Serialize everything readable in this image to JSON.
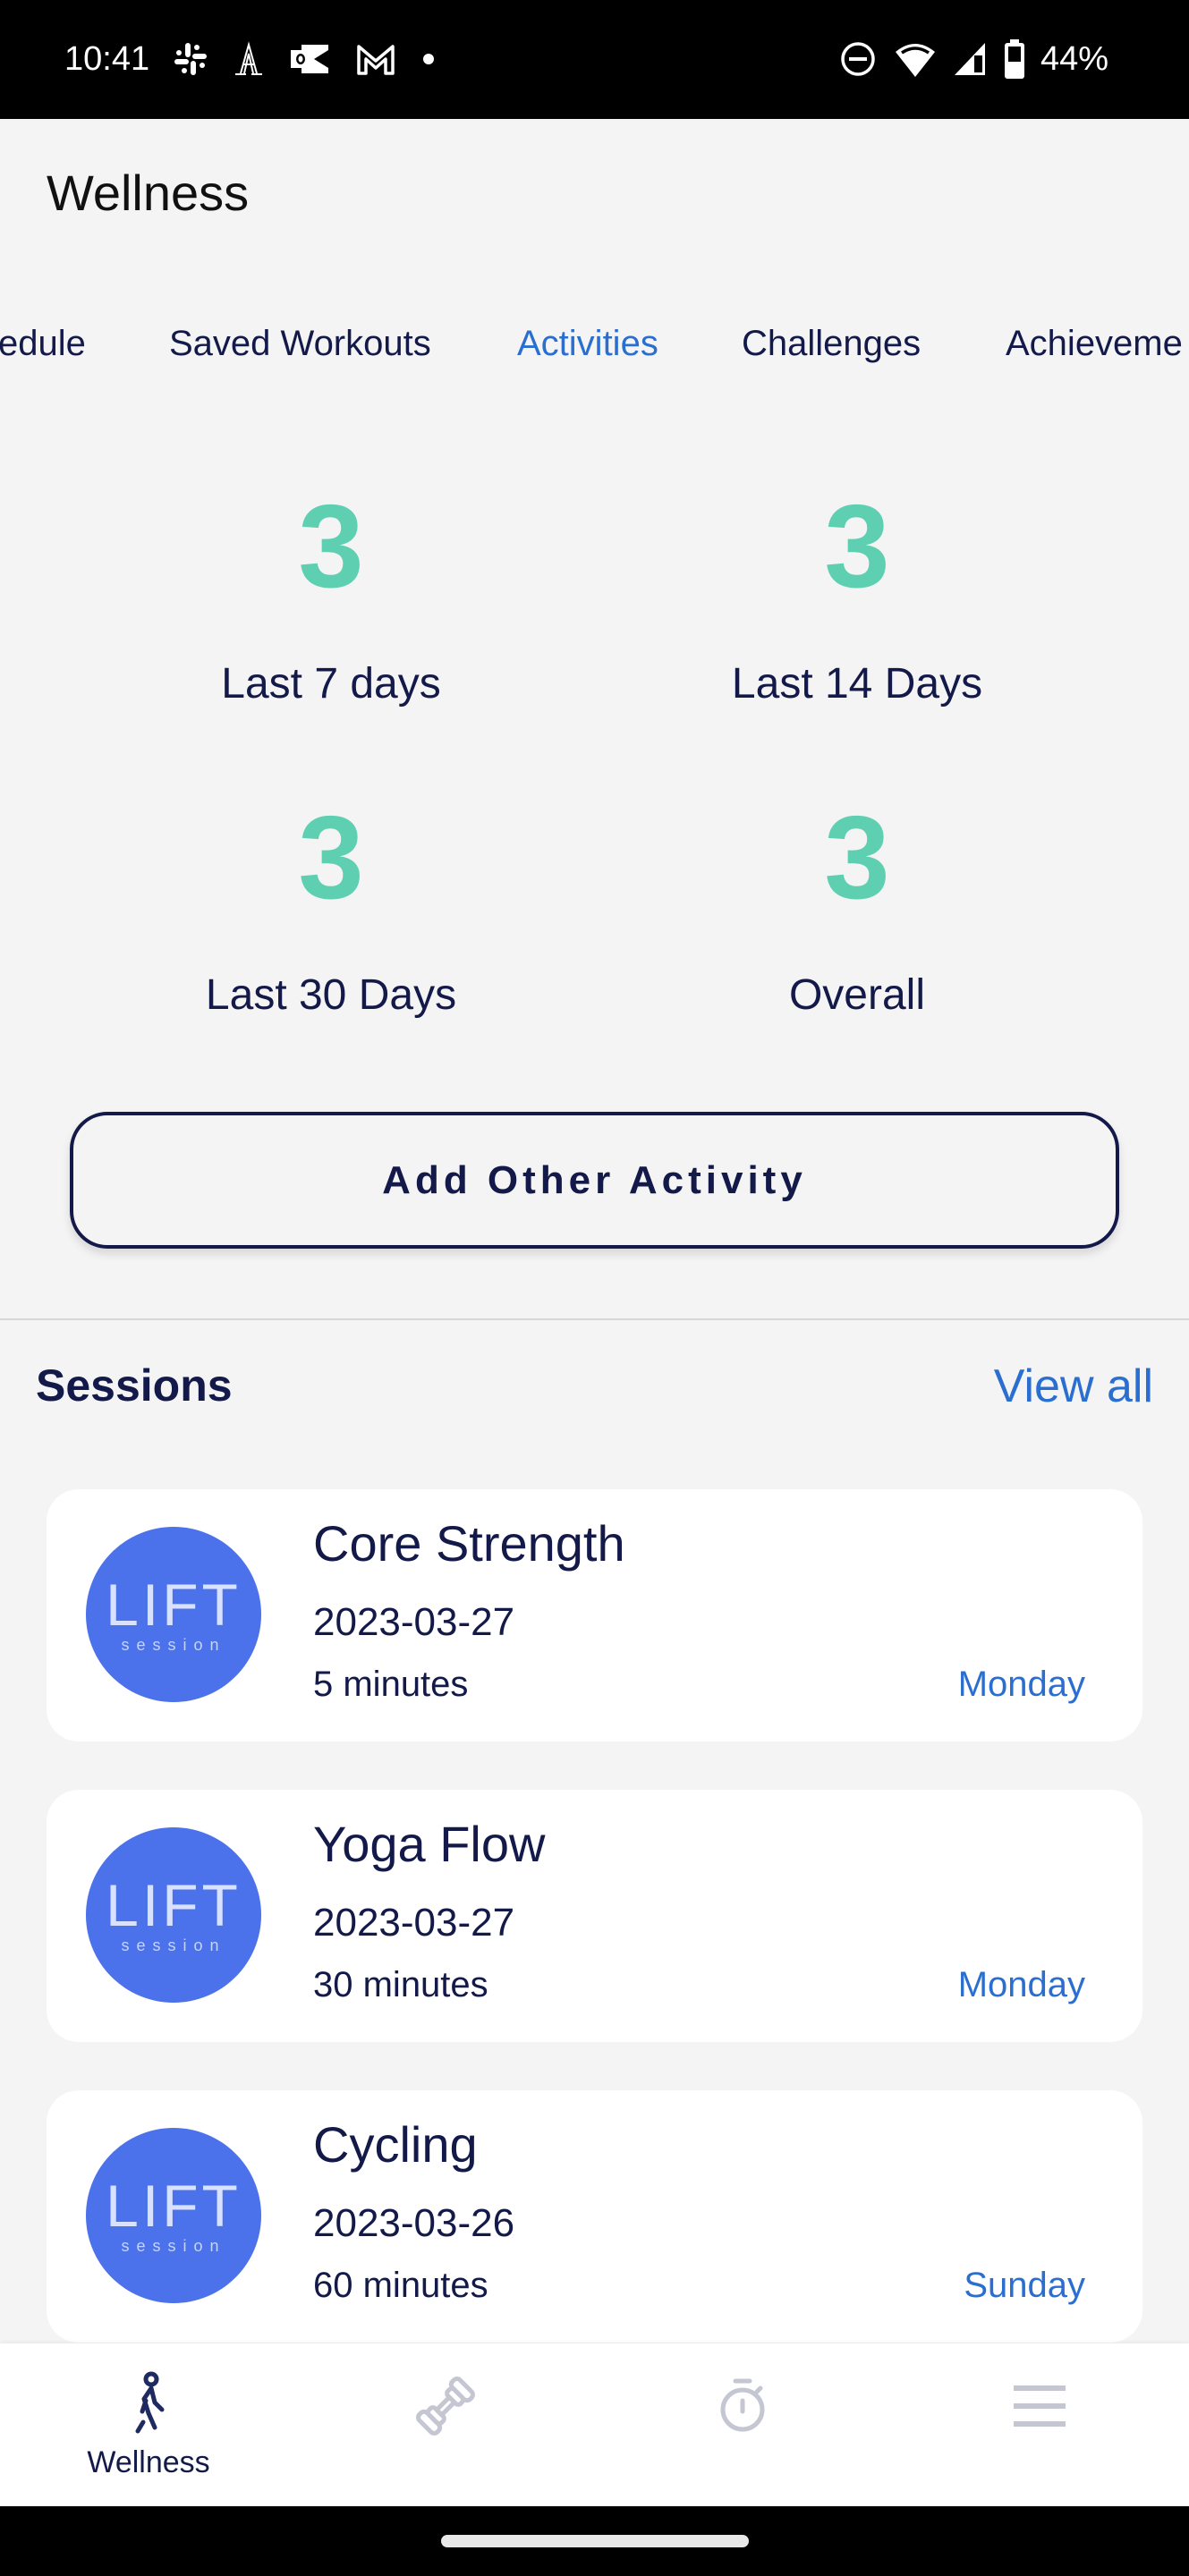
{
  "status_bar": {
    "time": "10:41",
    "notification_icons": [
      "slack-icon",
      "font-app-icon",
      "outlook-icon",
      "gmail-icon",
      "more-dot-icon"
    ],
    "system_icons": [
      "do-not-disturb-icon",
      "wifi-icon",
      "signal-icon",
      "battery-icon"
    ],
    "battery_percent": "44%"
  },
  "header": {
    "title": "Wellness"
  },
  "tabs": [
    {
      "label": "Schedule",
      "visible_text": "edule",
      "active": false
    },
    {
      "label": "Saved Workouts",
      "active": false
    },
    {
      "label": "Activities",
      "active": true
    },
    {
      "label": "Challenges",
      "active": false
    },
    {
      "label": "Achievements",
      "visible_text": "Achieveme",
      "active": false
    }
  ],
  "stats": [
    {
      "value": "3",
      "label": "Last 7 days"
    },
    {
      "value": "3",
      "label": "Last 14 Days"
    },
    {
      "value": "3",
      "label": "Last 30 Days"
    },
    {
      "value": "3",
      "label": "Overall"
    }
  ],
  "add_activity_button": "Add Other Activity",
  "sessions": {
    "title": "Sessions",
    "view_all": "View all",
    "items": [
      {
        "thumb_main": "LIFT",
        "thumb_sub": "session",
        "name": "Core Strength",
        "date": "2023-03-27",
        "duration": "5 minutes",
        "day": "Monday"
      },
      {
        "thumb_main": "LIFT",
        "thumb_sub": "session",
        "name": "Yoga Flow",
        "date": "2023-03-27",
        "duration": "30 minutes",
        "day": "Monday"
      },
      {
        "thumb_main": "LIFT",
        "thumb_sub": "session",
        "name": "Cycling",
        "date": "2023-03-26",
        "duration": "60 minutes",
        "day": "Sunday"
      }
    ]
  },
  "bottom_nav": [
    {
      "icon": "walking-person-icon",
      "label": "Wellness",
      "active": true
    },
    {
      "icon": "dumbbell-icon",
      "label": "",
      "active": false
    },
    {
      "icon": "stopwatch-icon",
      "label": "",
      "active": false
    },
    {
      "icon": "menu-icon",
      "label": "",
      "active": false
    }
  ],
  "colors": {
    "accent_blue": "#2a6fd0",
    "stat_green": "#5ecfb1",
    "navy_text": "#131a4a",
    "thumb_blue": "#4b72ea",
    "inactive_icon": "#c4c6d2"
  }
}
